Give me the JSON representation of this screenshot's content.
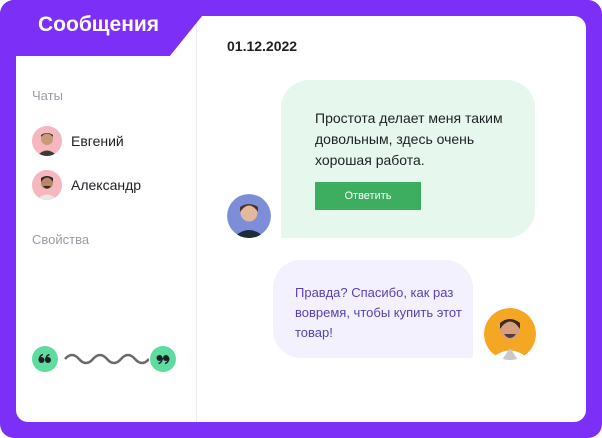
{
  "header": {
    "title": "Сообщения"
  },
  "sidebar": {
    "chats_heading": "Чаты",
    "contacts": [
      {
        "name": "Евгений",
        "avatar_icon": "man-avatar-icon"
      },
      {
        "name": "Александр",
        "avatar_icon": "man-avatar-icon"
      }
    ],
    "properties_heading": "Свойства"
  },
  "conversation": {
    "date": "01.12.2022",
    "incoming": {
      "text": "Простота делает меня таким довольным, здесь очень хорошая работа.",
      "reply_label": "Ответить"
    },
    "outgoing": {
      "text": "Правда? Спасибо, как раз вовремя, чтобы купить этот товар!"
    }
  },
  "colors": {
    "brand": "#7b2ff7",
    "incoming_bubble": "#e6f7ee",
    "outgoing_bubble": "#f2f1fd",
    "reply_button": "#3dae5f",
    "accent_green": "#5edca0"
  }
}
